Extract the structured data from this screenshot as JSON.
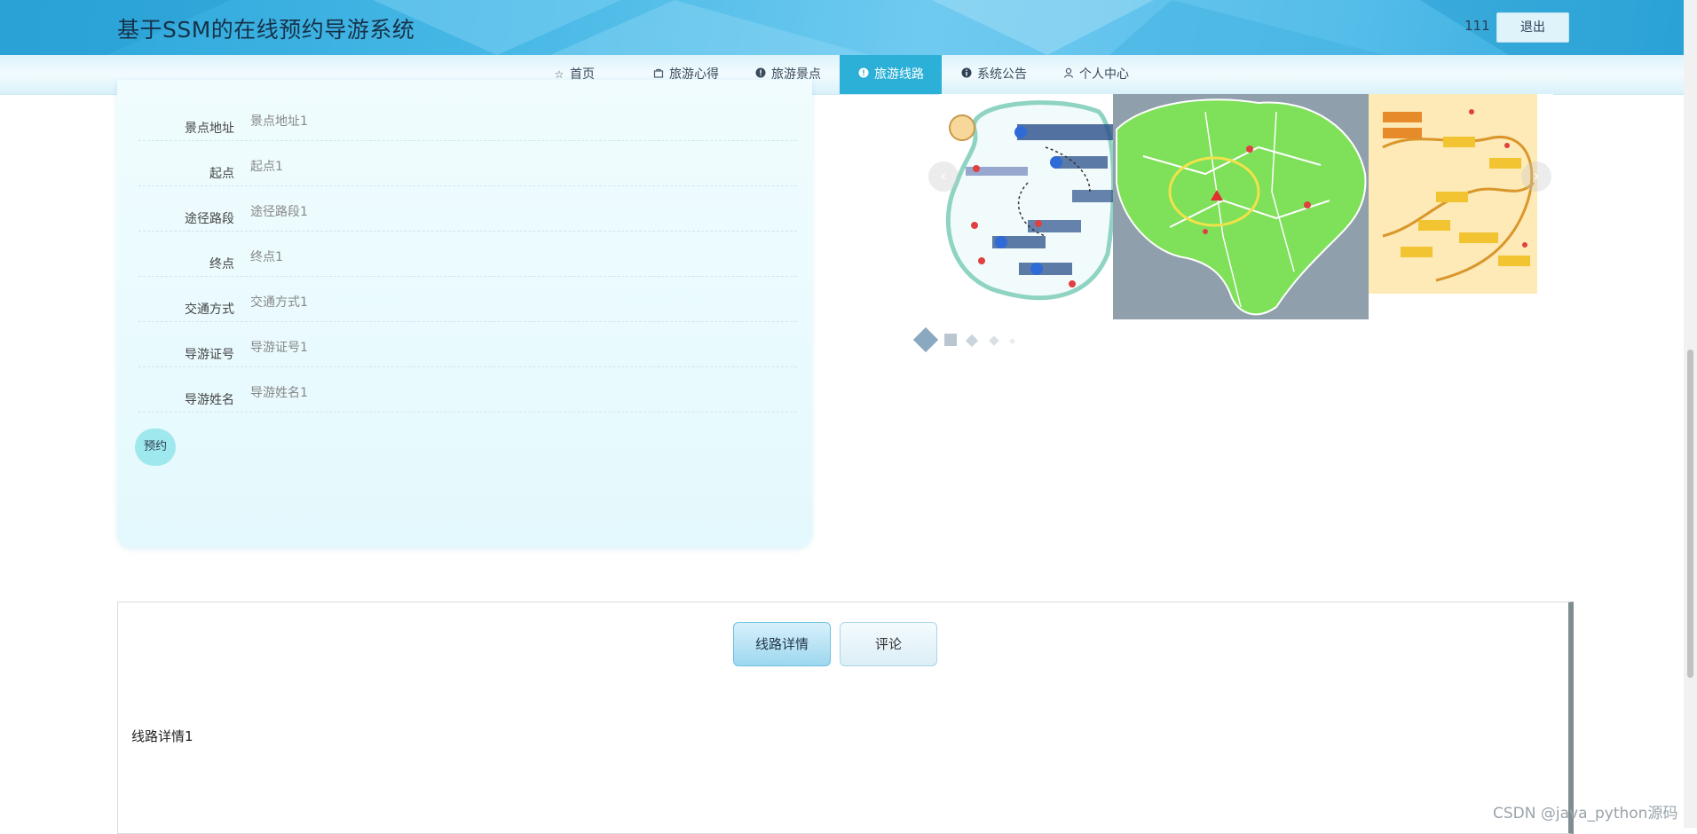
{
  "header": {
    "site_title": "基于SSM的在线预约导游系统",
    "username": "111",
    "logout_label": "退出"
  },
  "nav": {
    "items": [
      {
        "label": "首页",
        "icon": "star-outline-icon"
      },
      {
        "label": "旅游心得",
        "icon": "bag-icon"
      },
      {
        "label": "旅游景点",
        "icon": "exclamation-circle-icon"
      },
      {
        "label": "旅游线路",
        "icon": "exclamation-circle-icon",
        "active": true
      },
      {
        "label": "系统公告",
        "icon": "info-circle-icon"
      },
      {
        "label": "个人中心",
        "icon": "user-icon"
      }
    ]
  },
  "info": {
    "rows": [
      {
        "label": "景点地址",
        "value": "景点地址1"
      },
      {
        "label": "起点",
        "value": "起点1"
      },
      {
        "label": "途径路段",
        "value": "途径路段1"
      },
      {
        "label": "终点",
        "value": "终点1"
      },
      {
        "label": "交通方式",
        "value": "交通方式1"
      },
      {
        "label": "导游证号",
        "value": "导游证号1"
      },
      {
        "label": "导游姓名",
        "value": "导游姓名1"
      }
    ],
    "book_label": "预约"
  },
  "carousel": {
    "dots": 5,
    "active_dot": 0
  },
  "detail": {
    "tabs": [
      {
        "label": "线路详情",
        "active": true
      },
      {
        "label": "评论",
        "active": false
      }
    ],
    "content": "线路详情1"
  },
  "watermark": "CSDN @java_python源码",
  "colors": {
    "header_blue": "#47b8e6",
    "nav_active": "#2cb0d8",
    "panel_bg": "#e4f9fd",
    "book_button": "#9ee8ee"
  }
}
